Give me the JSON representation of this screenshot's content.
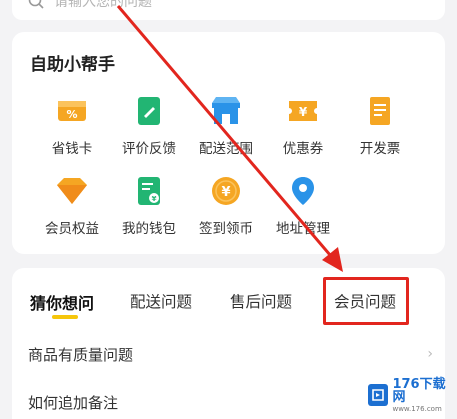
{
  "search": {
    "placeholder": "请输入您的问题",
    "icon": "search-icon"
  },
  "helper": {
    "title": "自助小帮手",
    "items": [
      {
        "label": "省钱卡",
        "icon": "discount-card-icon",
        "color": "#f5a623"
      },
      {
        "label": "评价反馈",
        "icon": "review-edit-icon",
        "color": "#22b573"
      },
      {
        "label": "配送范围",
        "icon": "store-range-icon",
        "color": "#2a93e8"
      },
      {
        "label": "优惠券",
        "icon": "coupon-icon",
        "color": "#f5a623"
      },
      {
        "label": "开发票",
        "icon": "invoice-icon",
        "color": "#f5a623"
      },
      {
        "label": "会员权益",
        "icon": "diamond-icon",
        "color": "#f5a623"
      },
      {
        "label": "我的钱包",
        "icon": "wallet-icon",
        "color": "#22b573"
      },
      {
        "label": "签到领币",
        "icon": "checkin-coin-icon",
        "color": "#f5a623"
      },
      {
        "label": "地址管理",
        "icon": "location-pin-icon",
        "color": "#2a93e8"
      }
    ]
  },
  "tabs": [
    {
      "label": "猜你想问",
      "active": true
    },
    {
      "label": "配送问题",
      "active": false
    },
    {
      "label": "售后问题",
      "active": false
    },
    {
      "label": "会员问题",
      "active": false
    }
  ],
  "questions": [
    {
      "text": "商品有质量问题"
    },
    {
      "text": "如何追加备注"
    }
  ],
  "colors": {
    "accent_yellow": "#f6c60b",
    "highlight_red": "#e2261e"
  },
  "watermark": {
    "main": "176下载网",
    "sub": "www.176.com"
  }
}
